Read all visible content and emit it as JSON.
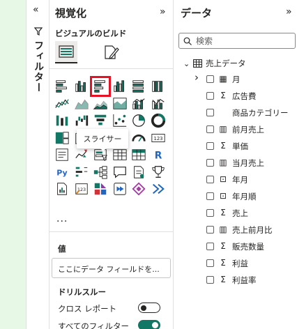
{
  "filters": {
    "collapse_glyph": "«",
    "label": "フィルター"
  },
  "viz": {
    "title": "視覚化",
    "expand_glyph": "»",
    "build_title": "ビジュアルのビルド",
    "more": "...",
    "tooltip": "スライサー",
    "values_label": "値",
    "values_placeholder": "ここにデータ フィールドを...",
    "drillthrough_label": "ドリルスルー",
    "cross_report_label": "クロス レポート",
    "cross_report_on": false,
    "all_filters_label": "すべてのフィルター",
    "all_filters_on": true,
    "accent": "#117865",
    "highlight": "#e81123",
    "icons": [
      "stacked-bar-chart-icon",
      "stacked-column-chart-icon",
      "clustered-bar-chart-icon",
      "clustered-column-chart-icon",
      "100-stacked-bar-chart-icon",
      "100-stacked-column-chart-icon",
      "line-chart-icon",
      "area-chart-icon",
      "stacked-area-chart-icon",
      "100-stacked-area-chart-icon",
      "line-stacked-column-chart-icon",
      "line-clustered-column-chart-icon",
      "ribbon-chart-icon",
      "waterfall-chart-icon",
      "funnel-chart-icon",
      "scatter-chart-icon",
      "pie-chart-icon",
      "donut-chart-icon",
      "treemap-icon",
      "map-icon",
      "filled-map-icon",
      "azure-map-icon",
      "gauge-icon",
      "card-icon",
      "multi-row-card-icon",
      "kpi-icon",
      "slicer-icon",
      "table-icon",
      "matrix-icon",
      "r-visual-icon",
      "python-visual-icon",
      "key-influencers-icon",
      "decomposition-tree-icon",
      "qa-icon",
      "smart-narrative-icon",
      "trophy-metrics-icon",
      "paginated-report-icon",
      "scorecard-icon",
      "power-apps-icon",
      "power-automate-icon",
      "diamond-visual-icon",
      "more-visuals-icon"
    ]
  },
  "data": {
    "title": "データ",
    "expand_glyph": "»",
    "search_placeholder": "検索",
    "table_name": "売上データ",
    "fields": [
      {
        "name": "月",
        "icon": "calendar-icon",
        "glyph": "▦",
        "expandable": true
      },
      {
        "name": "広告費",
        "icon": "sigma-icon",
        "glyph": "Σ",
        "expandable": false
      },
      {
        "name": "商品カテゴリー",
        "icon": "",
        "glyph": "",
        "expandable": false
      },
      {
        "name": "前月売上",
        "icon": "calculator-icon",
        "glyph": "▥",
        "expandable": false
      },
      {
        "name": "単価",
        "icon": "sigma-icon",
        "glyph": "Σ",
        "expandable": false
      },
      {
        "name": "当月売上",
        "icon": "calculator-icon",
        "glyph": "▥",
        "expandable": false
      },
      {
        "name": "年月",
        "icon": "calculated-column-icon",
        "glyph": "⊡",
        "expandable": false
      },
      {
        "name": "年月順",
        "icon": "calculated-column-icon",
        "glyph": "⊡",
        "expandable": false
      },
      {
        "name": "売上",
        "icon": "sigma-icon",
        "glyph": "Σ",
        "expandable": false
      },
      {
        "name": "売上前月比",
        "icon": "calculator-icon",
        "glyph": "▥",
        "expandable": false
      },
      {
        "name": "販売数量",
        "icon": "sigma-icon",
        "glyph": "Σ",
        "expandable": false
      },
      {
        "name": "利益",
        "icon": "sigma-icon",
        "glyph": "Σ",
        "expandable": false
      },
      {
        "name": "利益率",
        "icon": "sigma-icon",
        "glyph": "Σ",
        "expandable": false
      }
    ]
  }
}
